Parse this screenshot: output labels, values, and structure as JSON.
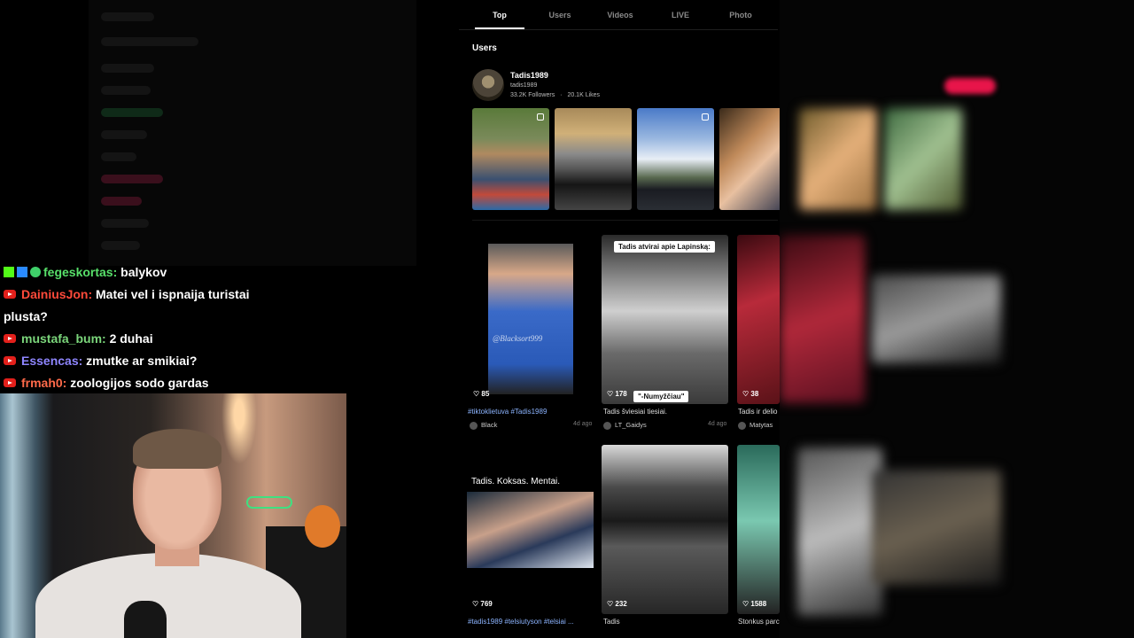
{
  "tabs": [
    {
      "label": "Top",
      "active": true
    },
    {
      "label": "Users",
      "active": false
    },
    {
      "label": "Videos",
      "active": false
    },
    {
      "label": "LIVE",
      "active": false
    },
    {
      "label": "Photo",
      "active": false
    }
  ],
  "users_section": {
    "title": "Users",
    "user": {
      "name": "Tadis1989",
      "handle": "tadis1989",
      "followers": "33.2K Followers",
      "likes": "20.1K Likes",
      "separator": "·"
    }
  },
  "videos": [
    {
      "likes": "85",
      "caption": "#tiktoklietuva #Tadis1989",
      "author": "Black",
      "age": "4d ago",
      "watermark": "@Blacksort999"
    },
    {
      "likes": "178",
      "caption": "Tadis šviesiai tiesiai.",
      "author": "LT_Gaidys",
      "age": "4d ago",
      "overlay_top": "Tadis atvirai apie Lapinską:",
      "overlay_bottom": "\"-Numyžčiau\""
    },
    {
      "likes": "38",
      "caption": "Tadis ir delio",
      "author": "Matytas",
      "age": ""
    },
    {
      "likes": "769",
      "caption": "#tadis1989 #telsiutyson #telsiai ...",
      "author": "",
      "age": "",
      "overlay_top": "Tadis. Koksas. Mentai."
    },
    {
      "likes": "232",
      "caption": "Tadis",
      "author": "",
      "age": ""
    },
    {
      "likes": "1588",
      "caption": "Stonkus parc",
      "author": "",
      "age": ""
    }
  ],
  "chat": [
    {
      "user": "fegeskortas:",
      "message": "balykov",
      "color": "#58e06a",
      "platform": "kick"
    },
    {
      "user": "DainiusJon:",
      "message": "Matei vel i ispnaija turistai",
      "message_cont": "plusta?",
      "color": "#ff4a3a",
      "platform": "youtube"
    },
    {
      "user": "mustafa_bum:",
      "message": "2 duhai",
      "color": "#7bd67b",
      "platform": "youtube"
    },
    {
      "user": "Essencas:",
      "message": "zmutke ar smikiai?",
      "color": "#8f86ff",
      "platform": "youtube"
    },
    {
      "user": "frmah0:",
      "message": "zoologijos sodo gardas",
      "color": "#ff6a4a",
      "platform": "youtube"
    }
  ],
  "icons": {
    "heart": "heart-icon",
    "multi": "carousel-icon",
    "youtube": "youtube-icon",
    "kick": "kick-icon"
  },
  "colors": {
    "accent": "#e8154a",
    "tag_blue": "#8cb4ff"
  }
}
